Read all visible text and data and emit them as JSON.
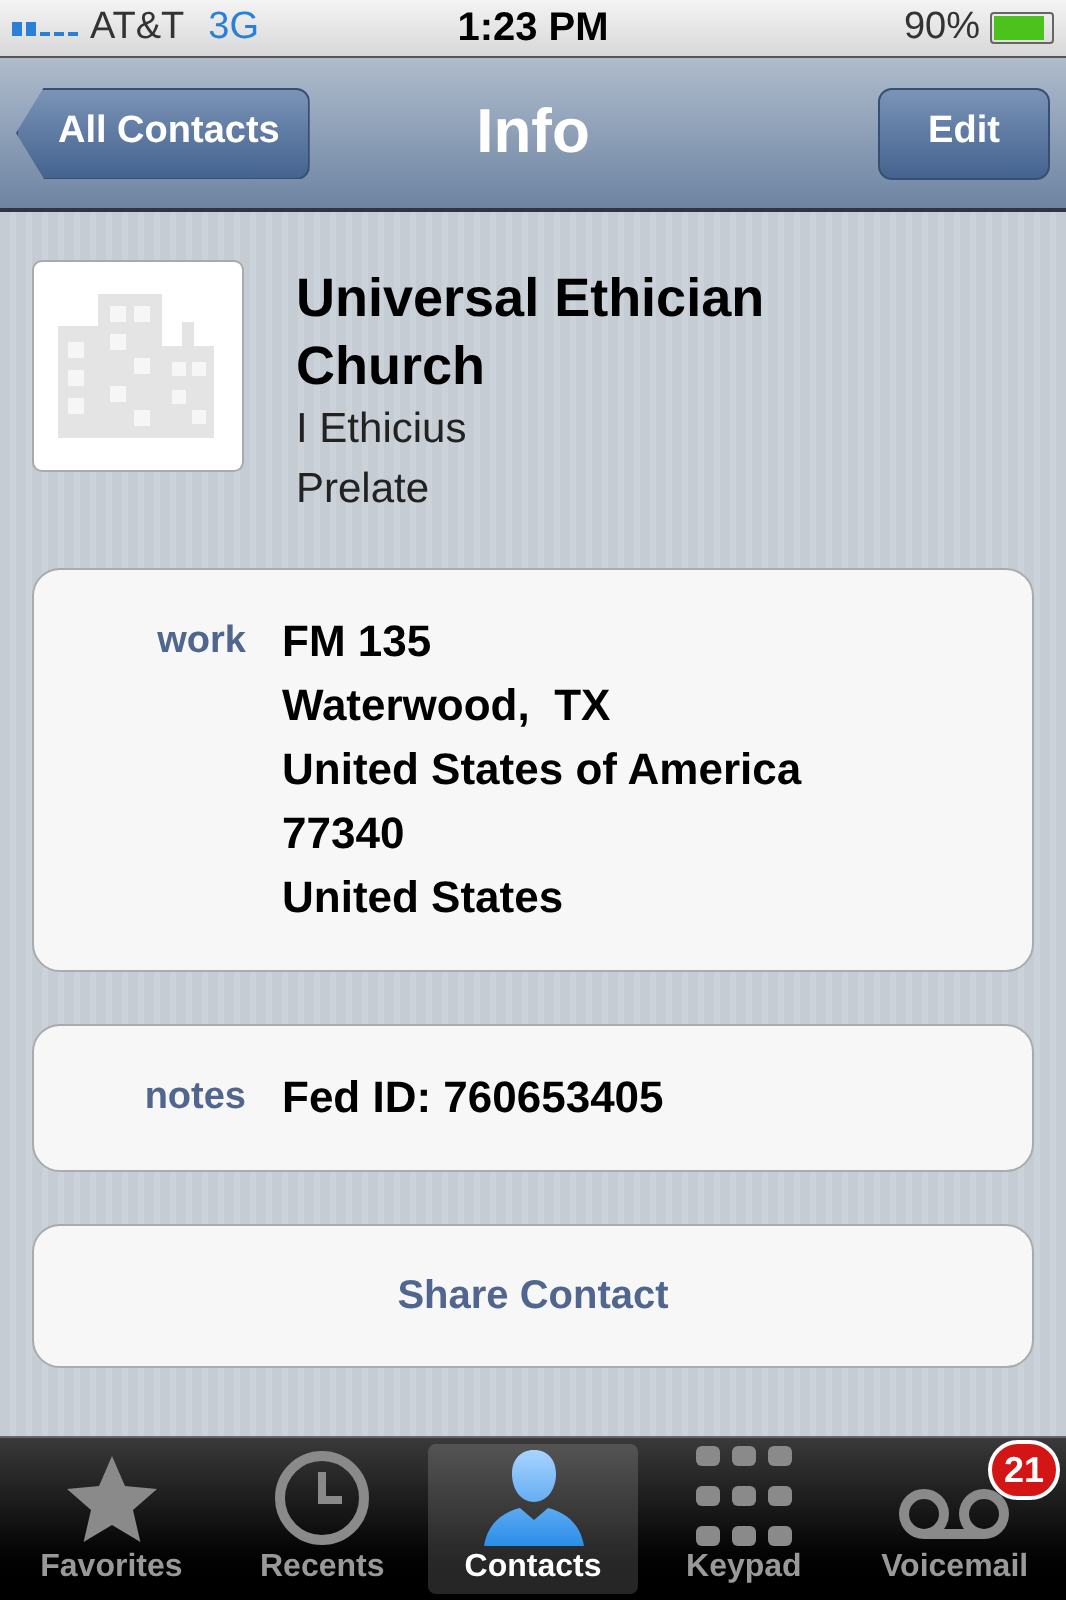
{
  "status_bar": {
    "carrier": "AT&T",
    "network": "3G",
    "time": "1:23 PM",
    "battery": "90%"
  },
  "nav": {
    "back": "All Contacts",
    "title": "Info",
    "action": "Edit"
  },
  "contact": {
    "name": "Universal Ethician Church",
    "person": "I Ethicius",
    "job_title": "Prelate"
  },
  "sections": [
    {
      "kind": "field",
      "label": "work",
      "lines": [
        "FM 135",
        "Waterwood,  TX",
        "United States of America",
        "77340",
        "United States"
      ]
    },
    {
      "kind": "field",
      "label": "notes",
      "lines": [
        "Fed ID: 760653405"
      ]
    },
    {
      "kind": "button",
      "text": "Share Contact"
    }
  ],
  "tabs": [
    {
      "label": "Favorites",
      "selected": false
    },
    {
      "label": "Recents",
      "selected": false
    },
    {
      "label": "Contacts",
      "selected": true
    },
    {
      "label": "Keypad",
      "selected": false
    },
    {
      "label": "Voicemail",
      "selected": false,
      "badge": "21"
    }
  ]
}
